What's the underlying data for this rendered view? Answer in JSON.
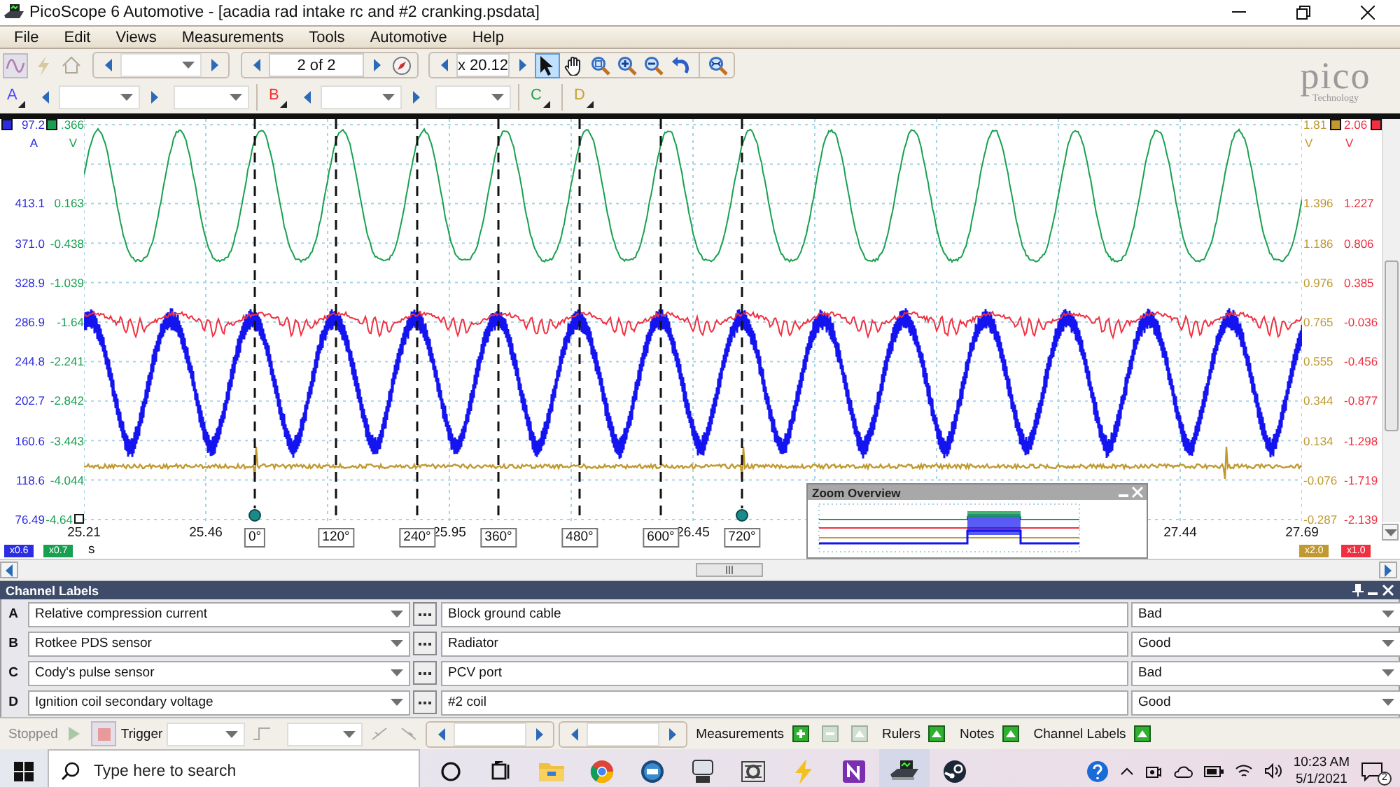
{
  "window": {
    "title": "PicoScope 6 Automotive - [acadia rad intake rc and #2 cranking.psdata]"
  },
  "menu": [
    "File",
    "Edit",
    "Views",
    "Measurements",
    "Tools",
    "Automotive",
    "Help"
  ],
  "toolbar": {
    "page": "2 of 2",
    "zoom": "x 20.12",
    "tools": [
      {
        "kind": "pointer",
        "selected": true
      },
      {
        "kind": "hand",
        "selected": false
      },
      {
        "kind": "zoom-area",
        "selected": false
      },
      {
        "kind": "zoom-in",
        "selected": false
      },
      {
        "kind": "zoom-out",
        "selected": false
      },
      {
        "kind": "undo",
        "selected": false
      },
      {
        "kind": "zoom-fit",
        "selected": false
      }
    ]
  },
  "logo": {
    "brand": "pico",
    "tagline": "Technology"
  },
  "channel_buttons": [
    {
      "letter": "A",
      "color": "#4a4aff",
      "kind": "full"
    },
    {
      "letter": "B",
      "color": "#f03030",
      "kind": "full"
    },
    {
      "letter": "C",
      "color": "#20a050",
      "kind": "compact"
    },
    {
      "letter": "D",
      "color": "#c8a030",
      "kind": "compact"
    }
  ],
  "scope": {
    "left_axes": [
      {
        "unit": "A",
        "color": "#2c2ce0",
        "scale": "x0.6",
        "ticks": [
          "97.2",
          "413.1",
          "371.0",
          "328.9",
          "286.9",
          "244.8",
          "202.7",
          "160.6",
          "118.6",
          "76.49"
        ]
      },
      {
        "unit": "V",
        "color": "#18a050",
        "scale": "x0.7",
        "ticks": [
          ".366",
          "0.163",
          "-0.438",
          "-1.039",
          "-1.64",
          "-2.241",
          "-2.842",
          "-3.443",
          "-4.044",
          "-4.64"
        ]
      }
    ],
    "right_axes": [
      {
        "unit": "V",
        "color": "#c09a30",
        "scale": "x2.0",
        "ticks": [
          "1.81",
          "1.396",
          "1.186",
          "0.976",
          "0.765",
          "0.555",
          "0.344",
          "0.134",
          "-0.076",
          "-0.287"
        ]
      },
      {
        "unit": "V",
        "color": "#f03040",
        "scale": "x1.0",
        "ticks": [
          "2.06",
          "1.227",
          "0.806",
          "0.385",
          "-0.036",
          "-0.456",
          "-0.877",
          "-1.298",
          "-1.719",
          "-2.139"
        ]
      }
    ],
    "time_ticks": [
      "25.21",
      "25.46",
      "25.95",
      "26.45",
      "27.44",
      "27.69"
    ],
    "time_unit": "s",
    "rulers": [
      "0°",
      "120°",
      "240°",
      "360°",
      "480°",
      "600°",
      "720°"
    ]
  },
  "zoom_overview": {
    "title": "Zoom Overview"
  },
  "channel_labels": {
    "title": "Channel Labels",
    "rows": [
      {
        "channel": "A",
        "probe": "Relative compression current",
        "location": "Block ground cable",
        "status": "Bad"
      },
      {
        "channel": "B",
        "probe": "Rotkee PDS sensor",
        "location": "Radiator",
        "status": "Good"
      },
      {
        "channel": "C",
        "probe": "Cody's pulse sensor",
        "location": "PCV port",
        "status": "Bad"
      },
      {
        "channel": "D",
        "probe": "Ignition coil secondary voltage",
        "location": "#2 coil",
        "status": "Good"
      }
    ]
  },
  "status_bar": {
    "state": "Stopped",
    "trigger": "Trigger",
    "run_controls": [
      {
        "kind": "play",
        "selected": false
      },
      {
        "kind": "stop",
        "selected": true
      }
    ],
    "measurements": "Measurements",
    "measurement_buttons": [
      {
        "kind": "add",
        "disabled": false
      },
      {
        "kind": "edit",
        "disabled": true
      },
      {
        "kind": "delete",
        "disabled": true
      }
    ],
    "panels": [
      "Rulers",
      "Notes",
      "Channel Labels"
    ]
  },
  "taskbar": {
    "search_placeholder": "Type here to search",
    "apps": [
      {
        "kind": "cortana",
        "active": false
      },
      {
        "kind": "task-view",
        "active": false
      },
      {
        "kind": "folder",
        "active": false
      },
      {
        "kind": "chrome",
        "active": false
      },
      {
        "kind": "round-app",
        "active": false
      },
      {
        "kind": "x64-app",
        "active": false
      },
      {
        "kind": "gear-app",
        "active": false
      },
      {
        "kind": "bolt",
        "active": false
      },
      {
        "kind": "onenote",
        "active": false
      },
      {
        "kind": "scope",
        "active": true
      },
      {
        "kind": "steam",
        "active": false
      }
    ],
    "time": "10:23 AM",
    "date": "5/1/2021",
    "notifications": "2"
  }
}
